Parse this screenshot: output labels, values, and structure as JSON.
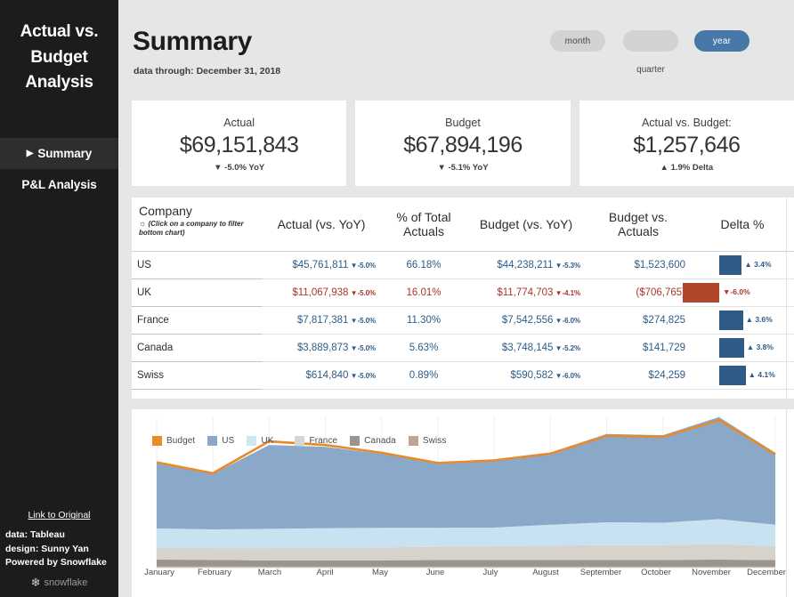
{
  "sidebar": {
    "title": "Actual vs. Budget Analysis",
    "nav": [
      {
        "label": "Summary",
        "caret": "▶",
        "active": true
      },
      {
        "label": "P&L Analysis",
        "caret": "",
        "active": false
      }
    ],
    "footer": {
      "link_label": "Link to Original",
      "credits": [
        "data: Tableau",
        "design: Sunny Yan",
        "Powered by Snowflake"
      ],
      "logo_text": "snowflake",
      "logo_glyph": "❄"
    }
  },
  "header": {
    "title": "Summary",
    "subtitle": "data through: December 31, 2018",
    "toggles": [
      {
        "label": "month",
        "selected": false
      },
      {
        "label": "",
        "selected": false
      },
      {
        "label": "year",
        "selected": true
      }
    ],
    "quarter_label": "quarter"
  },
  "kpis": [
    {
      "label": "Actual",
      "value": "$69,151,843",
      "delta": "▼ -5.0% YoY"
    },
    {
      "label": "Budget",
      "value": "$67,894,196",
      "delta": "▼ -5.1% YoY"
    },
    {
      "label": "Actual vs. Budget:",
      "value": "$1,257,646",
      "delta": "▲ 1.9% Delta"
    }
  ],
  "table": {
    "headers": {
      "company": "Company",
      "company_hint": "(Click on a company to filter bottom chart)",
      "actual": "Actual (vs. YoY)",
      "pct_total": "% of Total Actuals",
      "budget": "Budget (vs. YoY)",
      "budget_vs_actuals": "Budget vs. Actuals",
      "delta": "Delta %"
    },
    "rows": [
      {
        "company": "US",
        "actual": "$45,761,811",
        "actual_yoy": "-5.0%",
        "actual_arrow": "▼",
        "pct_total": "66.18%",
        "budget": "$44,238,211",
        "budget_yoy": "-5.3%",
        "budget_arrow": "▼",
        "budget_vs_actuals": "$1,523,600",
        "delta_pct": "3.4%",
        "delta_arrow": "▲",
        "delta_sign": "positive",
        "delta_value": 3.4
      },
      {
        "company": "UK",
        "actual": "$11,067,938",
        "actual_yoy": "-5.0%",
        "actual_arrow": "▼",
        "pct_total": "16.01%",
        "budget": "$11,774,703",
        "budget_yoy": "-4.1%",
        "budget_arrow": "▼",
        "budget_vs_actuals": "($706,765)",
        "delta_pct": "-6.0%",
        "delta_arrow": "▼",
        "delta_sign": "negative",
        "delta_value": -6.0
      },
      {
        "company": "France",
        "actual": "$7,817,381",
        "actual_yoy": "-5.0%",
        "actual_arrow": "▼",
        "pct_total": "11.30%",
        "budget": "$7,542,556",
        "budget_yoy": "-6.0%",
        "budget_arrow": "▼",
        "budget_vs_actuals": "$274,825",
        "delta_pct": "3.6%",
        "delta_arrow": "▲",
        "delta_sign": "positive",
        "delta_value": 3.6
      },
      {
        "company": "Canada",
        "actual": "$3,889,873",
        "actual_yoy": "-5.0%",
        "actual_arrow": "▼",
        "pct_total": "5.63%",
        "budget": "$3,748,145",
        "budget_yoy": "-5.2%",
        "budget_arrow": "▼",
        "budget_vs_actuals": "$141,729",
        "delta_pct": "3.8%",
        "delta_arrow": "▲",
        "delta_sign": "positive",
        "delta_value": 3.8
      },
      {
        "company": "Swiss",
        "actual": "$614,840",
        "actual_yoy": "-5.0%",
        "actual_arrow": "▼",
        "pct_total": "0.89%",
        "budget": "$590,582",
        "budget_yoy": "-6.0%",
        "budget_arrow": "▼",
        "budget_vs_actuals": "$24,259",
        "delta_pct": "4.1%",
        "delta_arrow": "▲",
        "delta_sign": "positive",
        "delta_value": 4.1
      }
    ]
  },
  "colors": {
    "positive": "#2f5c87",
    "negative": "#a8372a",
    "bar_positive": "#2f5c87",
    "bar_negative": "#b0462c",
    "accent_selected": "#4878a8",
    "budget_line": "#e8892b",
    "series_us": "#8aa9c8",
    "series_uk": "#c9e2f2",
    "series_france": "#d6d2cc",
    "series_canada": "#9a948d",
    "series_swiss": "#bf9d93",
    "sidebar_bg": "#1c1c1c",
    "page_bg": "#e6e6e6"
  },
  "chart_data": {
    "type": "area",
    "title": "",
    "xlabel": "",
    "ylabel": "",
    "grid": true,
    "legend_position": "top-left",
    "stacked": true,
    "x": [
      "January",
      "February",
      "March",
      "April",
      "May",
      "June",
      "July",
      "August",
      "September",
      "October",
      "November",
      "December"
    ],
    "legend": [
      "Budget",
      "US",
      "UK",
      "France",
      "Canada",
      "Swiss"
    ],
    "ylim": [
      0,
      7.4
    ],
    "series": [
      {
        "name": "Swiss",
        "color": "#bf9d93",
        "values": [
          0.06,
          0.06,
          0.05,
          0.05,
          0.05,
          0.05,
          0.05,
          0.05,
          0.05,
          0.05,
          0.05,
          0.05
        ]
      },
      {
        "name": "Canada",
        "color": "#9a948d",
        "values": [
          0.33,
          0.32,
          0.3,
          0.3,
          0.31,
          0.32,
          0.33,
          0.33,
          0.33,
          0.33,
          0.34,
          0.32
        ]
      },
      {
        "name": "France",
        "color": "#d6d2cc",
        "values": [
          0.58,
          0.57,
          0.6,
          0.62,
          0.63,
          0.65,
          0.66,
          0.7,
          0.72,
          0.72,
          0.76,
          0.68
        ]
      },
      {
        "name": "UK",
        "color": "#c9e2f2",
        "values": [
          0.95,
          0.92,
          0.95,
          0.96,
          0.96,
          0.93,
          0.92,
          1.02,
          1.12,
          1.1,
          1.22,
          1.05
        ]
      },
      {
        "name": "US",
        "color": "#8aa9c8",
        "values": [
          3.18,
          2.72,
          4.1,
          3.98,
          3.62,
          3.12,
          3.25,
          3.52,
          4.32,
          4.28,
          5.0,
          3.52
        ]
      }
    ],
    "budget_line": {
      "name": "Budget",
      "color": "#e8892b",
      "values": [
        5.15,
        4.62,
        6.18,
        6.0,
        5.62,
        5.12,
        5.25,
        5.58,
        6.45,
        6.4,
        7.22,
        5.55
      ]
    }
  }
}
